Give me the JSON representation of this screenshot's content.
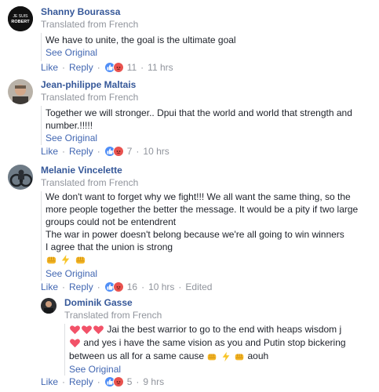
{
  "comments": [
    {
      "name": "Shanny Bourassa",
      "translated": "Translated from French",
      "lines": [
        "We have to unite, the goal is the ultimate goal"
      ],
      "see_original": "See Original",
      "like": "Like",
      "reply": "Reply",
      "reaction_count": "11",
      "time": "11 hrs",
      "avatar_text": [
        "JE SUIS",
        "ROBERT"
      ]
    },
    {
      "name": "Jean-philippe Maltais",
      "translated": "Translated from French",
      "lines": [
        "Together we will stronger.. Dpui that the world and world that strength and",
        "number.!!!!!"
      ],
      "see_original": "See Original",
      "like": "Like",
      "reply": "Reply",
      "reaction_count": "7",
      "time": "10 hrs"
    },
    {
      "name": "Melanie Vincelette",
      "translated": "Translated from French",
      "lines": [
        "We don't want to forget why we fight!!! We all want the same thing, so the",
        "more people together the better the message. It would be a pity if two large",
        "groups could not be entendrent",
        "The war in power doesn't belong because we're all going to win winners",
        "I agree that the union is strong"
      ],
      "see_original": "See Original",
      "like": "Like",
      "reply": "Reply",
      "reaction_count": "16",
      "time": "10 hrs",
      "edited": "Edited"
    }
  ],
  "reply": {
    "name": "Dominik Gasse",
    "translated": "Translated from French",
    "line1": "Jai the best warrior to go to the end with heaps wisdom j",
    "line2": "and yes i have the same vision as you and Putin stop bickering",
    "line3": "between us all for a same cause",
    "line3_end": "aouh",
    "see_original": "See Original",
    "like": "Like",
    "reply": "Reply",
    "reaction_count": "5",
    "time": "9 hrs"
  },
  "colors": {
    "name": "#365899",
    "link": "#4267b2",
    "muted": "#90949c",
    "like_reaction": "#4f8ef7",
    "angry_reaction": "#e9534f",
    "heart": "#f25268",
    "fist": "#f5b728",
    "lightning": "#f8c52a"
  },
  "icons": [
    "like-reaction-icon",
    "angry-reaction-icon",
    "heart-icon",
    "fist-icon",
    "lightning-icon"
  ]
}
